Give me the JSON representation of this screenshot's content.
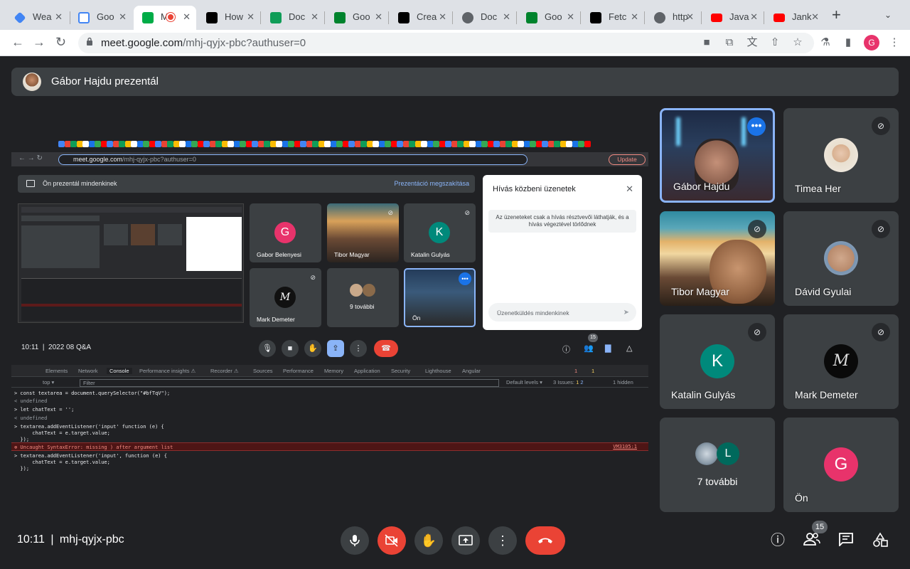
{
  "browser": {
    "tabs": [
      {
        "label": "Wea",
        "color": "#4285f4"
      },
      {
        "label": "Goo",
        "color": "#fbbc04"
      },
      {
        "label": "M",
        "color": "#00ac47"
      },
      {
        "label": "How",
        "color": "#000000"
      },
      {
        "label": "Doc",
        "color": "#0f9d58"
      },
      {
        "label": "Goo",
        "color": "#00832d"
      },
      {
        "label": "Crea",
        "color": "#000000"
      },
      {
        "label": "Doc",
        "color": "#5f6368"
      },
      {
        "label": "Goo",
        "color": "#00832d"
      },
      {
        "label": "Fetc",
        "color": "#000000"
      },
      {
        "label": "http",
        "color": "#5f6368"
      },
      {
        "label": "Java",
        "color": "#ff0000"
      },
      {
        "label": "Jank",
        "color": "#ff0000"
      }
    ],
    "url_host": "meet.google.com",
    "url_path": "/mhj-qyjx-pbc?authuser=0",
    "profile_initial": "G"
  },
  "banner": {
    "presenter_text": "Gábor Hajdu prezentál"
  },
  "presentation": {
    "url_host": "meet.google.com",
    "url_path": "/mhj-qyjx-pbc?authuser=0",
    "update_label": "Update",
    "presenting_text": "Ön prezentál mindenkinek",
    "stop_label": "Prezentáció megszakítása",
    "tiles": [
      {
        "name": "Gabor Belenyesi",
        "initial": "G",
        "color": "#e8336b"
      },
      {
        "name": "Tibor Magyar"
      },
      {
        "name": "Katalin Gulyás",
        "initial": "K",
        "color": "#00897b"
      },
      {
        "name": "Mark Demeter"
      },
      {
        "name": "9 további"
      },
      {
        "name": "Ön"
      }
    ],
    "chat_title": "Hívás közbeni üzenetek",
    "chat_info": "Az üzeneteket csak a hívás résztvevői láthatják, és a hívás végeztével törlődnek",
    "chat_placeholder": "Üzenetküldés mindenkinek",
    "time_text": "10:11",
    "meeting_text": "2022 08 Q&A",
    "people_count": "15"
  },
  "devtools": {
    "tabs": [
      "Elements",
      "Network",
      "Console",
      "Performance insights ⚠",
      "Recorder ⚠",
      "Sources",
      "Performance",
      "Memory",
      "Application",
      "Security",
      "Lighthouse",
      "Angular"
    ],
    "context": "top ▾",
    "filter_placeholder": "Filter",
    "levels": "Default levels ▾",
    "issues": "3 Issues:",
    "issues_warn": "1",
    "issues_info": "2",
    "hidden": "1 hidden",
    "err_badge": "1",
    "warn_badge": "1",
    "lines": [
      "> const textarea = document.querySelector(\"#bfTqV\");",
      "< undefined",
      "> let chatText = '';",
      "< undefined",
      "> textarea.addEventListener('input' function (e) {",
      "      chatText = e.target.value;",
      "  });",
      "⊗ Uncaught SyntaxError: missing ) after argument list",
      "> textarea.addEventListener('input', function (e) {",
      "      chatText = e.target.value;",
      "  });"
    ],
    "error_source": "VM3105:1"
  },
  "tiles": [
    {
      "name": "Gábor Hajdu",
      "kind": "video"
    },
    {
      "name": "Timea Her",
      "kind": "photo"
    },
    {
      "name": "Tibor Magyar",
      "kind": "video"
    },
    {
      "name": "Dávid Gyulai",
      "kind": "photo"
    },
    {
      "name": "Katalin Gulyás",
      "initial": "K",
      "color": "#00897b"
    },
    {
      "name": "Mark Demeter",
      "kind": "logo"
    },
    {
      "name": "7 további",
      "initial": "L",
      "color": "#00796b"
    },
    {
      "name": "Ön",
      "initial": "G",
      "color": "#e8336b"
    }
  ],
  "bottom": {
    "time": "10:11",
    "separator": "|",
    "meeting_code": "mhj-qyjx-pbc",
    "people_count": "15"
  }
}
